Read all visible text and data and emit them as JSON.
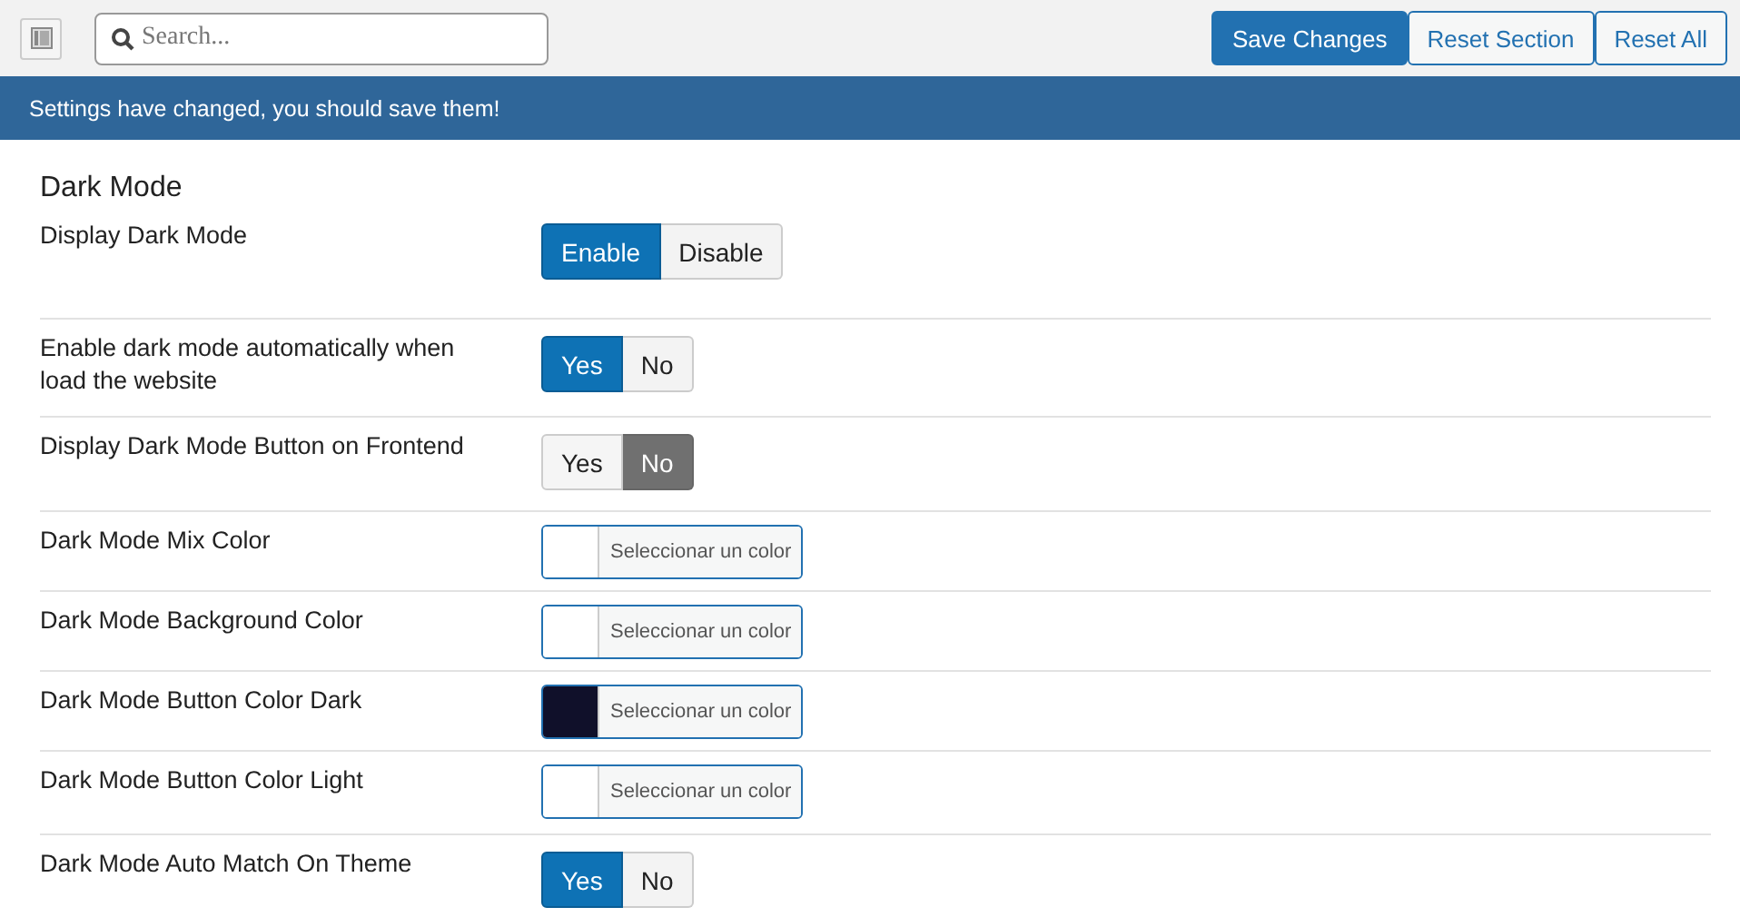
{
  "toolbar": {
    "search": {
      "placeholder": "Search..."
    },
    "buttons": [
      {
        "label": "Save Changes",
        "kind": "primary"
      },
      {
        "label": "Reset Section",
        "kind": "secondary"
      },
      {
        "label": "Reset All",
        "kind": "secondary"
      }
    ]
  },
  "notice": "Settings have changed, you should save them!",
  "section": {
    "title": "Dark Mode",
    "settings": [
      {
        "kind": "toggle",
        "label": "Display Dark Mode",
        "options": [
          {
            "label": "Enable",
            "kind": "positive",
            "selected": true
          },
          {
            "label": "Disable",
            "kind": "negative",
            "selected": false
          }
        ]
      },
      {
        "kind": "toggle",
        "label": "Enable dark mode automatically when load the website",
        "options": [
          {
            "label": "Yes",
            "kind": "positive",
            "selected": true
          },
          {
            "label": "No",
            "kind": "negative",
            "selected": false
          }
        ]
      },
      {
        "kind": "toggle",
        "label": "Display Dark Mode Button on Frontend",
        "options": [
          {
            "label": "Yes",
            "kind": "positive",
            "selected": false
          },
          {
            "label": "No",
            "kind": "negative",
            "selected": true
          }
        ]
      },
      {
        "kind": "color",
        "label": "Dark Mode Mix Color",
        "color": "#ffffff",
        "button_label": "Seleccionar un color"
      },
      {
        "kind": "color",
        "label": "Dark Mode Background Color",
        "color": "#ffffff",
        "button_label": "Seleccionar un color"
      },
      {
        "kind": "color",
        "label": "Dark Mode Button Color Dark",
        "color": "#10102a",
        "button_label": "Seleccionar un color"
      },
      {
        "kind": "color",
        "label": "Dark Mode Button Color Light",
        "color": "#ffffff",
        "button_label": "Seleccionar un color"
      },
      {
        "kind": "toggle",
        "label": "Dark Mode Auto Match On Theme",
        "options": [
          {
            "label": "Yes",
            "kind": "positive",
            "selected": true
          },
          {
            "label": "No",
            "kind": "negative",
            "selected": false
          }
        ]
      }
    ]
  }
}
